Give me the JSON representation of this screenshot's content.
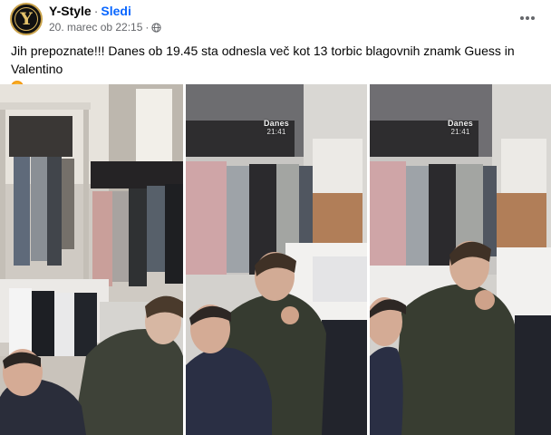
{
  "post": {
    "author": "Y-Style",
    "separator": "·",
    "follow_label": "Sledi",
    "timestamp": "20. marec ob 22:15",
    "separator2": "·",
    "audience_icon": "globe-icon",
    "menu_icon": "more-horizontal-icon",
    "avatar_letter": "Y",
    "caption": "Jih prepoznate!!! Danes ob 19.45 sta odnesla več kot 13 torbic blagovnih znamk Guess in Valentino",
    "caption_emoji": "angry-face-emoji"
  },
  "photos": [
    {
      "alt": "CCTV frame 1"
    },
    {
      "alt": "CCTV frame 2",
      "overlay_label": "Danes",
      "overlay_time": "21:41"
    },
    {
      "alt": "CCTV frame 3",
      "overlay_label": "Danes",
      "overlay_time": "21:41"
    }
  ],
  "colors": {
    "accent": "#0866ff",
    "secondary_text": "#65676b",
    "avatar_gold": "#c9a24a"
  }
}
